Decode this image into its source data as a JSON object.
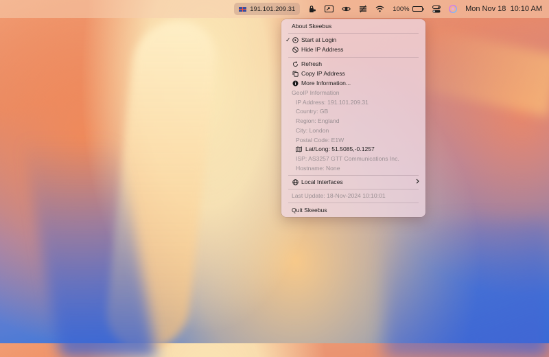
{
  "menubar": {
    "ip_address": "191.101.209.31",
    "battery_percent": "100%",
    "battery_level": 1.0,
    "datetime": "Mon Nov 18  10:10 AM",
    "icons": [
      "uk-flag-icon",
      "lock-person-icon",
      "screen-share-icon",
      "eye-icon",
      "stack-icon",
      "wifi-icon",
      "battery-icon",
      "control-center-icon",
      "siri-icon"
    ]
  },
  "menu": {
    "about": "About Skeebus",
    "start_at_login": "Start at Login",
    "start_at_login_checked": true,
    "hide_ip": "Hide IP Address",
    "refresh": "Refresh",
    "copy_ip": "Copy IP Address",
    "more_info": "More Information...",
    "geoip_header": "GeoIP Information",
    "geoip": {
      "ip": "IP Address: 191.101.209.31",
      "country": "Country: GB",
      "region": "Region: England",
      "city": "City: London",
      "postal": "Postal Code: E1W",
      "latlong": "Lat/Long: 51.5085,-0.1257",
      "isp": "ISP: AS3257 GTT Communications Inc.",
      "hostname": "Hostname: None"
    },
    "local_interfaces": "Local Interfaces",
    "last_update": "Last Update: 18-Nov-2024 10:10:01",
    "quit": "Quit Skeebus"
  }
}
